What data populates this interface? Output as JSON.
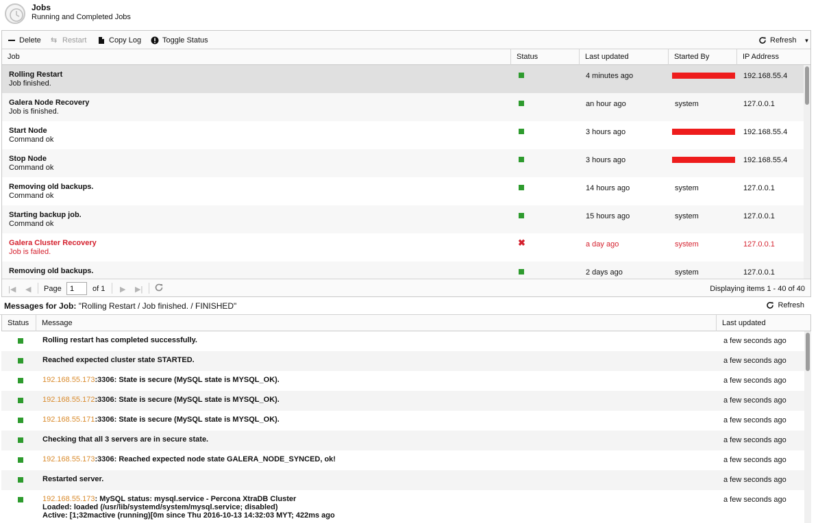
{
  "header": {
    "title": "Jobs",
    "subtitle": "Running and Completed Jobs",
    "icon": "clock-icon"
  },
  "toolbar": {
    "delete_label": "Delete",
    "restart_label": "Restart",
    "copy_log_label": "Copy Log",
    "toggle_status_label": "Toggle Status",
    "refresh_label": "Refresh"
  },
  "jobs_grid": {
    "columns": [
      "Job",
      "Status",
      "Last updated",
      "Started By",
      "IP Address"
    ],
    "rows": [
      {
        "name": "Rolling Restart",
        "message": "Job finished.",
        "status": "ok",
        "updated": "4 minutes ago",
        "started_by": "",
        "redacted": true,
        "ip": "192.168.55.4"
      },
      {
        "name": "Galera Node Recovery",
        "message": "Job is finished.",
        "status": "ok",
        "updated": "an hour ago",
        "started_by": "system",
        "redacted": false,
        "ip": "127.0.0.1"
      },
      {
        "name": "Start Node",
        "message": "Command ok",
        "status": "ok",
        "updated": "3 hours ago",
        "started_by": "",
        "redacted": true,
        "ip": "192.168.55.4"
      },
      {
        "name": "Stop Node",
        "message": "Command ok",
        "status": "ok",
        "updated": "3 hours ago",
        "started_by": "",
        "redacted": true,
        "ip": "192.168.55.4"
      },
      {
        "name": "Removing old backups.",
        "message": "Command ok",
        "status": "ok",
        "updated": "14 hours ago",
        "started_by": "system",
        "redacted": false,
        "ip": "127.0.0.1"
      },
      {
        "name": "Starting backup job.",
        "message": "Command ok",
        "status": "ok",
        "updated": "15 hours ago",
        "started_by": "system",
        "redacted": false,
        "ip": "127.0.0.1"
      },
      {
        "name": "Galera Cluster Recovery",
        "message": "Job is failed.",
        "status": "failed",
        "updated": "a day ago",
        "started_by": "system",
        "redacted": false,
        "ip": "127.0.0.1"
      },
      {
        "name": "Removing old backups.",
        "message": "",
        "status": "ok",
        "updated": "2 days ago",
        "started_by": "system",
        "redacted": false,
        "ip": "127.0.0.1"
      }
    ]
  },
  "pager": {
    "page_label": "Page",
    "page_value": "1",
    "of_label": "of 1",
    "info": "Displaying items 1 - 40 of 40"
  },
  "messages": {
    "title_prefix": "Messages for Job:",
    "title_value": "\"Rolling Restart / Job finished. / FINISHED\"",
    "refresh_label": "Refresh",
    "columns": [
      "Status",
      "Message",
      "Last updated"
    ],
    "rows": [
      {
        "ip": "",
        "text": "Rolling restart has completed successfully.",
        "time": "a few seconds ago"
      },
      {
        "ip": "",
        "text": "Reached expected cluster state STARTED.",
        "time": "a few seconds ago"
      },
      {
        "ip": "192.168.55.173",
        "text": ":3306: State is secure (MySQL state is MYSQL_OK).",
        "time": "a few seconds ago"
      },
      {
        "ip": "192.168.55.172",
        "text": ":3306: State is secure (MySQL state is MYSQL_OK).",
        "time": "a few seconds ago"
      },
      {
        "ip": "192.168.55.171",
        "text": ":3306: State is secure (MySQL state is MYSQL_OK).",
        "time": "a few seconds ago"
      },
      {
        "ip": "",
        "text": "Checking that all 3 servers are in secure state.",
        "time": "a few seconds ago"
      },
      {
        "ip": "192.168.55.173",
        "text": ":3306: Reached expected node state GALERA_NODE_SYNCED, ok!",
        "time": "a few seconds ago"
      },
      {
        "ip": "",
        "text": "Restarted server.",
        "time": "a few seconds ago"
      },
      {
        "ip": "192.168.55.173",
        "text": ": MySQL status: mysql.service - Percona XtraDB Cluster",
        "time": "a few seconds ago",
        "extra": [
          "Loaded: loaded (/usr/lib/systemd/system/mysql.service; disabled)",
          "Active: [1;32mactive (running)[0m since Thu 2016-10-13 14:32:03 MYT; 422ms ago"
        ]
      }
    ]
  },
  "colors": {
    "ok": "#2e9b2e",
    "failed": "#d41f2c",
    "ip_link": "#d98a2b",
    "redaction": "#ee1c1c"
  }
}
